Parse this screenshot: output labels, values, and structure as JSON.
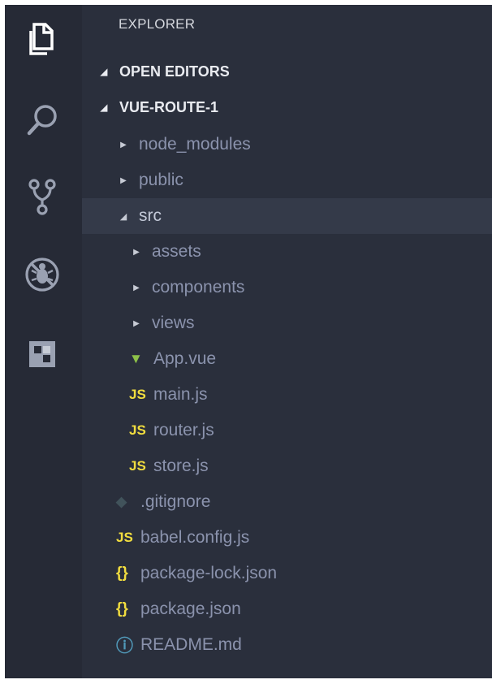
{
  "activity_bar": {
    "icons": [
      "files-icon",
      "search-icon",
      "source-control-icon",
      "debug-icon",
      "extensions-icon"
    ]
  },
  "explorer": {
    "title": "EXPLORER",
    "sections": {
      "open_editors": "OPEN EDITORS",
      "project": "VUE-ROUTE-1"
    },
    "tree": [
      {
        "label": "node_modules",
        "kind": "folder",
        "expanded": false,
        "icon": "chevron-right-icon"
      },
      {
        "label": "public",
        "kind": "folder",
        "expanded": false,
        "icon": "chevron-right-icon"
      },
      {
        "label": "src",
        "kind": "folder",
        "expanded": true,
        "selected": true,
        "icon": "chevron-down-icon"
      },
      {
        "label": "assets",
        "kind": "folder",
        "expanded": false,
        "icon": "chevron-right-icon"
      },
      {
        "label": "components",
        "kind": "folder",
        "expanded": false,
        "icon": "chevron-right-icon"
      },
      {
        "label": "views",
        "kind": "folder",
        "expanded": false,
        "icon": "chevron-right-icon"
      },
      {
        "label": "App.vue",
        "kind": "file",
        "icon": "vue-icon",
        "icon_glyph": "▼"
      },
      {
        "label": "main.js",
        "kind": "file",
        "icon": "js-icon",
        "icon_glyph": "JS"
      },
      {
        "label": "router.js",
        "kind": "file",
        "icon": "js-icon",
        "icon_glyph": "JS"
      },
      {
        "label": "store.js",
        "kind": "file",
        "icon": "js-icon",
        "icon_glyph": "JS"
      },
      {
        "label": ".gitignore",
        "kind": "file",
        "icon": "git-icon",
        "icon_glyph": "◆"
      },
      {
        "label": "babel.config.js",
        "kind": "file",
        "icon": "js-icon",
        "icon_glyph": "JS"
      },
      {
        "label": "package-lock.json",
        "kind": "file",
        "icon": "json-icon",
        "icon_glyph": "{}"
      },
      {
        "label": "package.json",
        "kind": "file",
        "icon": "json-icon",
        "icon_glyph": "{}"
      },
      {
        "label": "README.md",
        "kind": "file",
        "icon": "info-icon",
        "icon_glyph": "ⓘ"
      }
    ]
  },
  "colors": {
    "background": "#262a36",
    "selected_row": "#343a49",
    "js": "#f1dd3f",
    "vue": "#8dc149",
    "info": "#519aba"
  }
}
